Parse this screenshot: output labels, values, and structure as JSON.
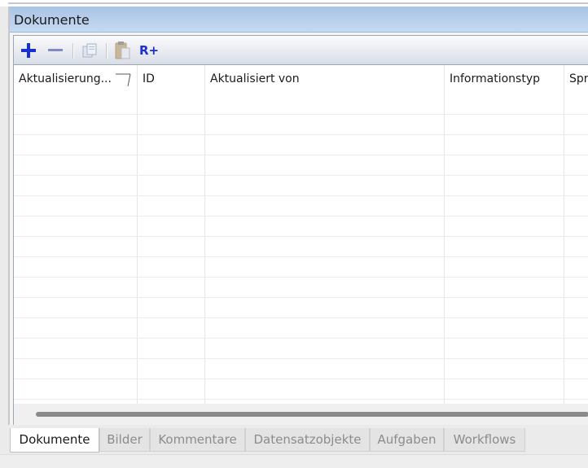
{
  "panel": {
    "title": "Dokumente"
  },
  "toolbar": {
    "buttons": [
      {
        "name": "add",
        "icon": "plus-icon",
        "label": "+"
      },
      {
        "name": "remove",
        "icon": "minus-icon",
        "label": "−"
      },
      {
        "name": "copy",
        "icon": "copy-icon"
      },
      {
        "name": "paste",
        "icon": "paste-icon"
      },
      {
        "name": "add-reference",
        "icon": "r-plus-icon",
        "label": "R+"
      }
    ]
  },
  "grid": {
    "columns": [
      {
        "label": "Aktualisierung...",
        "sorted": true
      },
      {
        "label": "ID"
      },
      {
        "label": "Aktualisiert von"
      },
      {
        "label": "Informationstyp"
      },
      {
        "label": "Spr"
      }
    ],
    "rows": []
  },
  "tabs": [
    {
      "label": "Dokumente",
      "active": true
    },
    {
      "label": "Bilder"
    },
    {
      "label": "Kommentare"
    },
    {
      "label": "Datensatzobjekte"
    },
    {
      "label": "Aufgaben"
    },
    {
      "label": "Workflows"
    }
  ],
  "colors": {
    "accent": "#1a2fd0",
    "header_bg": "#b7cdea"
  }
}
